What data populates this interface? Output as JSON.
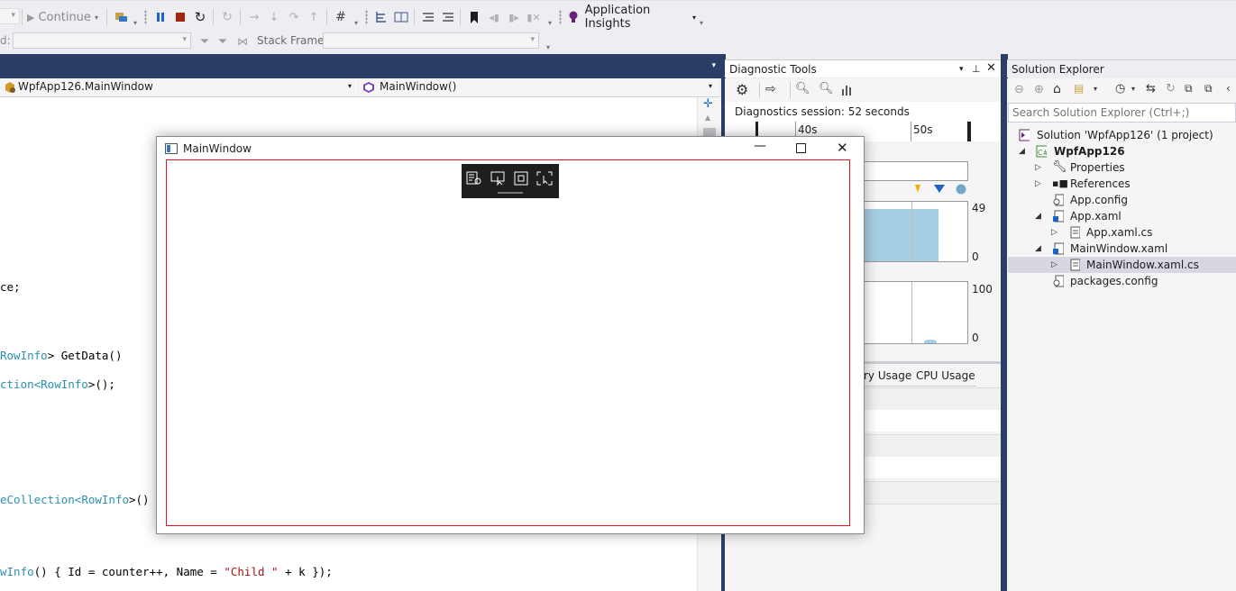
{
  "toolbar": {
    "continue_label": "Continue",
    "app_insights_label": "Application Insights",
    "thread_label": "d:",
    "stack_frame_label": "Stack Frame:",
    "stack_frame_value": ""
  },
  "editor": {
    "nav_class": "WpfApp126.MainWindow",
    "nav_member": "MainWindow()",
    "code_lines": [
      {
        "a": "ce;",
        "b": "",
        "c": "",
        "d": ""
      },
      {
        "a": "",
        "b": "RowInfo",
        "c": "> GetData()",
        "d": ""
      },
      {
        "a": "",
        "b": "ction<",
        "c": "",
        "d": ""
      },
      {
        "a": "",
        "b": "eCollection<",
        "c": "",
        "d": ""
      },
      {
        "a": "",
        "b": "wInfo",
        "c": "() { Id = counter++, Name = ",
        "d": "\"Child \""
      }
    ],
    "line2_type2": "RowInfo",
    "line2_tail": ">();",
    "line3_type2": "RowInfo",
    "line3_tail": ">()",
    "line4_tail": " + k });"
  },
  "app_window": {
    "title": "MainWindow"
  },
  "diagnostic_tools": {
    "title": "Diagnostic Tools",
    "session_text": "Diagnostics session: 52 seconds",
    "ruler_labels": [
      "40s",
      "50s"
    ],
    "memory_max": "49",
    "memory_min": "0",
    "cpu_max": "100",
    "cpu_min": "0",
    "tabs": [
      "ry Usage",
      "CPU Usage"
    ],
    "memory_fill_fraction": 0.9
  },
  "solution_explorer": {
    "title": "Solution Explorer",
    "search_placeholder": "Search Solution Explorer (Ctrl+;)",
    "items": [
      {
        "label": "Solution 'WpfApp126' (1 project)"
      },
      {
        "label": "WpfApp126"
      },
      {
        "label": "Properties"
      },
      {
        "label": "References"
      },
      {
        "label": "App.config"
      },
      {
        "label": "App.xaml"
      },
      {
        "label": "App.xaml.cs"
      },
      {
        "label": "MainWindow.xaml"
      },
      {
        "label": "MainWindow.xaml.cs"
      },
      {
        "label": "packages.config"
      }
    ]
  },
  "colors": {
    "accent_tab": "#2b3e66",
    "window_content_border": "#e81123",
    "chart_fill": "#a6cfe3"
  }
}
